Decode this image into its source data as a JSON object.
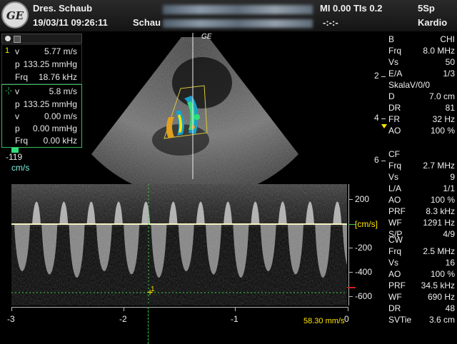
{
  "header": {
    "logo": "GE",
    "institution": "Dres. Schaub",
    "datetime": "19/03/11 09:26:11",
    "patient_prefix": "Schau",
    "mi_tis": "MI 0.00  TIs 0.2",
    "probe": "5Sp",
    "timer": "-:-:-",
    "preset": "Kardio"
  },
  "measure1": {
    "index": "1",
    "rows": [
      {
        "k": "v",
        "v": "5.77 m/s"
      },
      {
        "k": "p",
        "v": "133.25 mmHg"
      },
      {
        "k": "Frq",
        "v": "18.76 kHz"
      }
    ]
  },
  "measure2": {
    "index": "-¦-",
    "rows": [
      {
        "k": "v",
        "v": "5.8 m/s"
      },
      {
        "k": "p",
        "v": "133.25 mmHg"
      },
      {
        "k": "v",
        "v": "0.00 m/s"
      },
      {
        "k": "p",
        "v": "0.00 mmHg"
      },
      {
        "k": "Frq",
        "v": "0.00 kHz"
      }
    ]
  },
  "color_scale": {
    "value": "-119",
    "unit": "cm/s"
  },
  "sector_label": "GE",
  "depth_marks": [
    "2",
    "4",
    "6"
  ],
  "params_b": [
    {
      "k": "B",
      "v": "CHI"
    },
    {
      "k": "Frq",
      "v": "8.0 MHz"
    },
    {
      "k": "Vs",
      "v": "50"
    },
    {
      "k": "E/A",
      "v": "1/3"
    },
    {
      "k": "SkalaV/0/0",
      "v": ""
    },
    {
      "k": "D",
      "v": "7.0 cm"
    },
    {
      "k": "DR",
      "v": "81"
    },
    {
      "k": "FR",
      "v": "32 Hz"
    },
    {
      "k": "AO",
      "v": "100 %"
    }
  ],
  "params_cf": [
    {
      "k": "CF",
      "v": ""
    },
    {
      "k": "Frq",
      "v": "2.7 MHz"
    },
    {
      "k": "Vs",
      "v": "9"
    },
    {
      "k": "L/A",
      "v": "1/1"
    },
    {
      "k": "AO",
      "v": "100 %"
    },
    {
      "k": "PRF",
      "v": "8.3 kHz"
    },
    {
      "k": "WF",
      "v": "1291 Hz"
    },
    {
      "k": "S/P",
      "v": "4/9"
    }
  ],
  "params_cw": [
    {
      "k": "CW",
      "v": ""
    },
    {
      "k": "Frq",
      "v": "2.5 MHz"
    },
    {
      "k": "Vs",
      "v": "16"
    },
    {
      "k": "AO",
      "v": "100 %"
    },
    {
      "k": "PRF",
      "v": "34.5 kHz"
    },
    {
      "k": "WF",
      "v": "690 Hz"
    },
    {
      "k": "DR",
      "v": "48"
    },
    {
      "k": "SVTie",
      "v": "3.6 cm"
    }
  ],
  "doppler_axis": {
    "y_ticks": [
      "200",
      "-200",
      "-400",
      "-600"
    ],
    "y_unit": "[cm/s]",
    "x_ticks": [
      "-3",
      "-2",
      "-1",
      "0"
    ],
    "sweep_speed": "58.30 mm/s",
    "cursor_label": "1"
  },
  "colors": {
    "green_frame": "#2fbf5a",
    "label_yellow": "#ffe600",
    "cyan_unit": "#7ff0e0"
  }
}
